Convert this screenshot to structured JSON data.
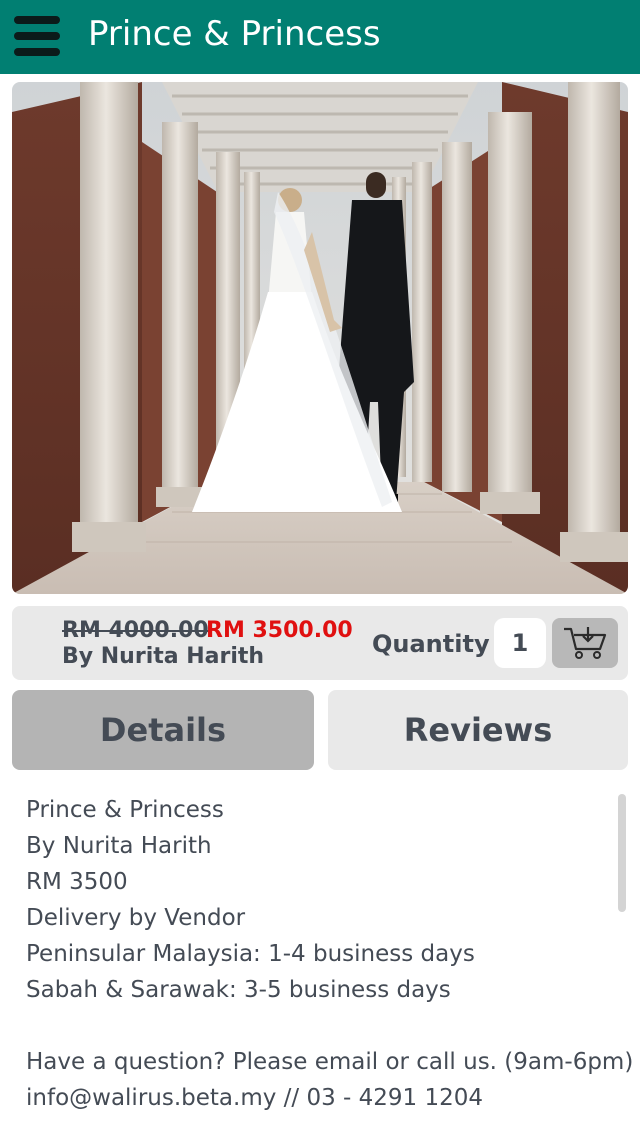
{
  "app_bar": {
    "title": "Prince & Princess",
    "menu_icon": "hamburger-menu-icon",
    "color": "#017f72"
  },
  "product": {
    "image_icon": "wedding-couple-photo",
    "old_price": "RM 4000.00",
    "new_price": "RM 3500.00",
    "vendor": "By Nurita Harith",
    "quantity_label": "Quantity",
    "quantity_value": "1",
    "cart_icon": "add-to-cart-icon",
    "sale_color": "#e01010"
  },
  "tabs": [
    {
      "label": "Details",
      "active": true
    },
    {
      "label": "Reviews",
      "active": false
    }
  ],
  "details": {
    "lines": [
      "Prince & Princess",
      "By Nurita Harith",
      "RM 3500",
      "Delivery by Vendor",
      "Peninsular Malaysia: 1-4 business days",
      "Sabah & Sarawak: 3-5 business days"
    ],
    "contact": [
      "Have a question? Please email or call us. (9am-6pm)",
      "info@walirus.beta.my // 03 - 4291 1204"
    ]
  }
}
